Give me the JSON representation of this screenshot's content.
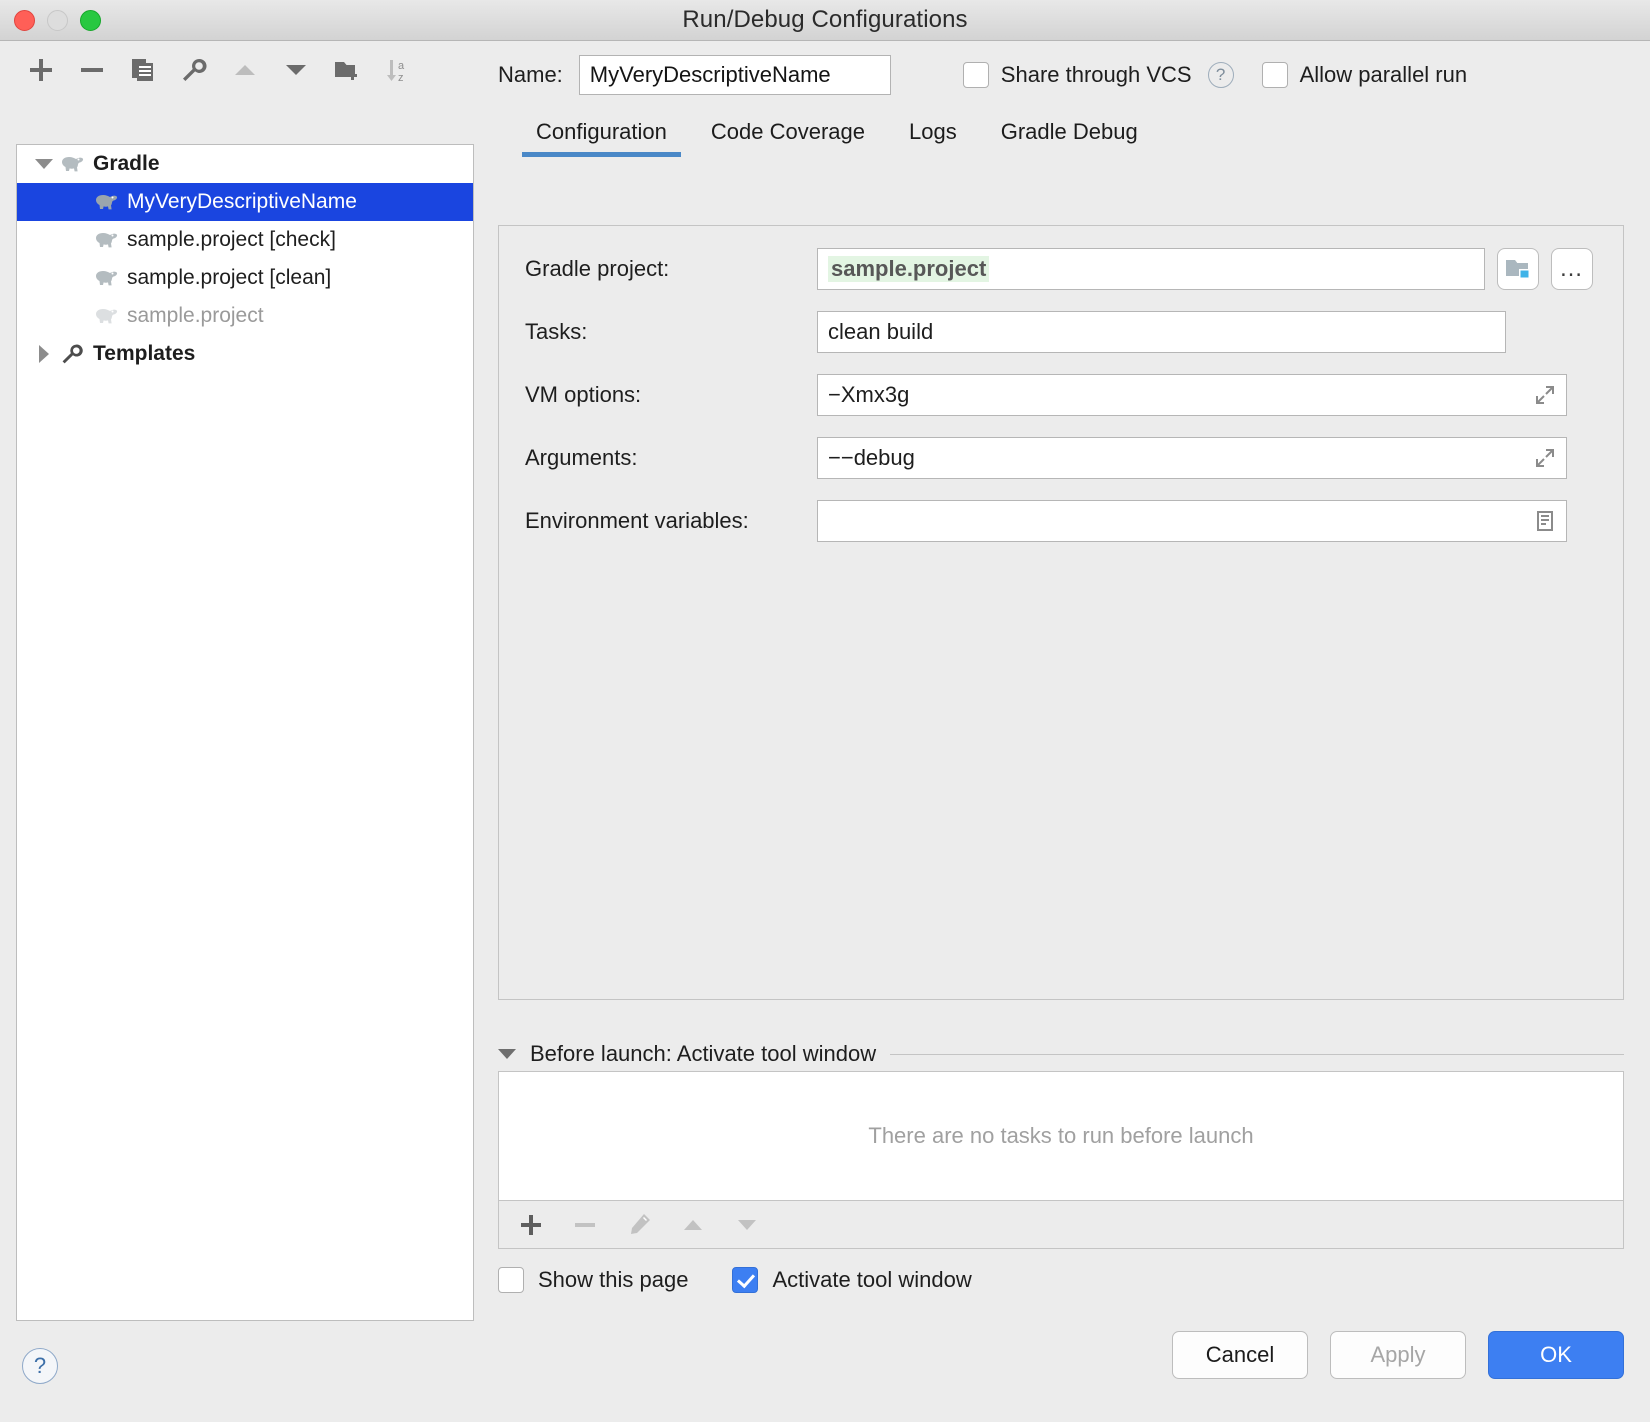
{
  "window": {
    "title": "Run/Debug Configurations",
    "traffic_lights": [
      "close",
      "minimize",
      "maximize"
    ]
  },
  "left_toolbar": {
    "items": [
      {
        "name": "add-configuration",
        "icon": "plus-icon"
      },
      {
        "name": "remove-configuration",
        "icon": "minus-icon"
      },
      {
        "name": "copy-configuration",
        "icon": "copy-icon"
      },
      {
        "name": "edit-templates",
        "icon": "wrench-icon"
      },
      {
        "name": "move-up",
        "icon": "triangle-up-icon"
      },
      {
        "name": "move-down",
        "icon": "triangle-down-icon"
      },
      {
        "name": "move-into-folder",
        "icon": "folder-add-icon"
      },
      {
        "name": "sort-alphabetically",
        "icon": "sort-az-icon"
      }
    ]
  },
  "tree": {
    "nodes": [
      {
        "label": "Gradle",
        "icon": "gradle-elephant-icon",
        "level": 0,
        "twisty": "down",
        "bold": true,
        "state": "normal"
      },
      {
        "label": "MyVeryDescriptiveName",
        "icon": "gradle-elephant-icon",
        "level": 1,
        "twisty": "none",
        "bold": false,
        "state": "selected"
      },
      {
        "label": "sample.project [check]",
        "icon": "gradle-elephant-icon",
        "level": 1,
        "twisty": "none",
        "bold": false,
        "state": "normal"
      },
      {
        "label": "sample.project [clean]",
        "icon": "gradle-elephant-icon",
        "level": 1,
        "twisty": "none",
        "bold": false,
        "state": "normal"
      },
      {
        "label": "sample.project",
        "icon": "gradle-elephant-icon",
        "level": 1,
        "twisty": "none",
        "bold": false,
        "state": "dim"
      },
      {
        "label": "Templates",
        "icon": "wrench-icon",
        "level": 0,
        "twisty": "right",
        "bold": true,
        "state": "normal"
      }
    ]
  },
  "header": {
    "name_label": "Name:",
    "name_value": "MyVeryDescriptiveName",
    "share_vcs_label": "Share through VCS",
    "share_vcs_checked": false,
    "help_glyph": "?",
    "allow_parallel_label": "Allow parallel run",
    "allow_parallel_checked": false
  },
  "tabs": {
    "items": [
      {
        "label": "Configuration",
        "active": true
      },
      {
        "label": "Code Coverage",
        "active": false
      },
      {
        "label": "Logs",
        "active": false
      },
      {
        "label": "Gradle Debug",
        "active": false
      }
    ],
    "active_underline_color": "#4a88c7"
  },
  "form": {
    "gradle_project_label": "Gradle project:",
    "gradle_project_value": "sample.project",
    "gradle_project_highlight_color": "#e3f5e3",
    "tasks_label": "Tasks:",
    "tasks_value": "clean build",
    "vm_options_label": "VM options:",
    "vm_options_value": "−Xmx3g",
    "arguments_label": "Arguments:",
    "arguments_value": "−−debug",
    "env_vars_label": "Environment variables:",
    "env_vars_value": "",
    "browse_module_icon": "folder-module-icon",
    "ellipsis_button_label": "…"
  },
  "before_launch": {
    "title": "Before launch: Activate tool window",
    "empty_text": "There are no tasks to run before launch",
    "toolbar": [
      {
        "name": "add-task",
        "icon": "plus-icon",
        "enabled": true
      },
      {
        "name": "remove-task",
        "icon": "minus-icon",
        "enabled": false
      },
      {
        "name": "edit-task",
        "icon": "pencil-icon",
        "enabled": false
      },
      {
        "name": "move-task-up",
        "icon": "triangle-up-icon",
        "enabled": false
      },
      {
        "name": "move-task-down",
        "icon": "triangle-down-icon",
        "enabled": false
      }
    ],
    "show_page_label": "Show this page",
    "show_page_checked": false,
    "activate_tool_window_label": "Activate tool window",
    "activate_tool_window_checked": true
  },
  "footer": {
    "help_glyph": "?",
    "cancel_label": "Cancel",
    "apply_label": "Apply",
    "apply_enabled": false,
    "ok_label": "OK",
    "ok_accent_color": "#3d7ff2"
  }
}
